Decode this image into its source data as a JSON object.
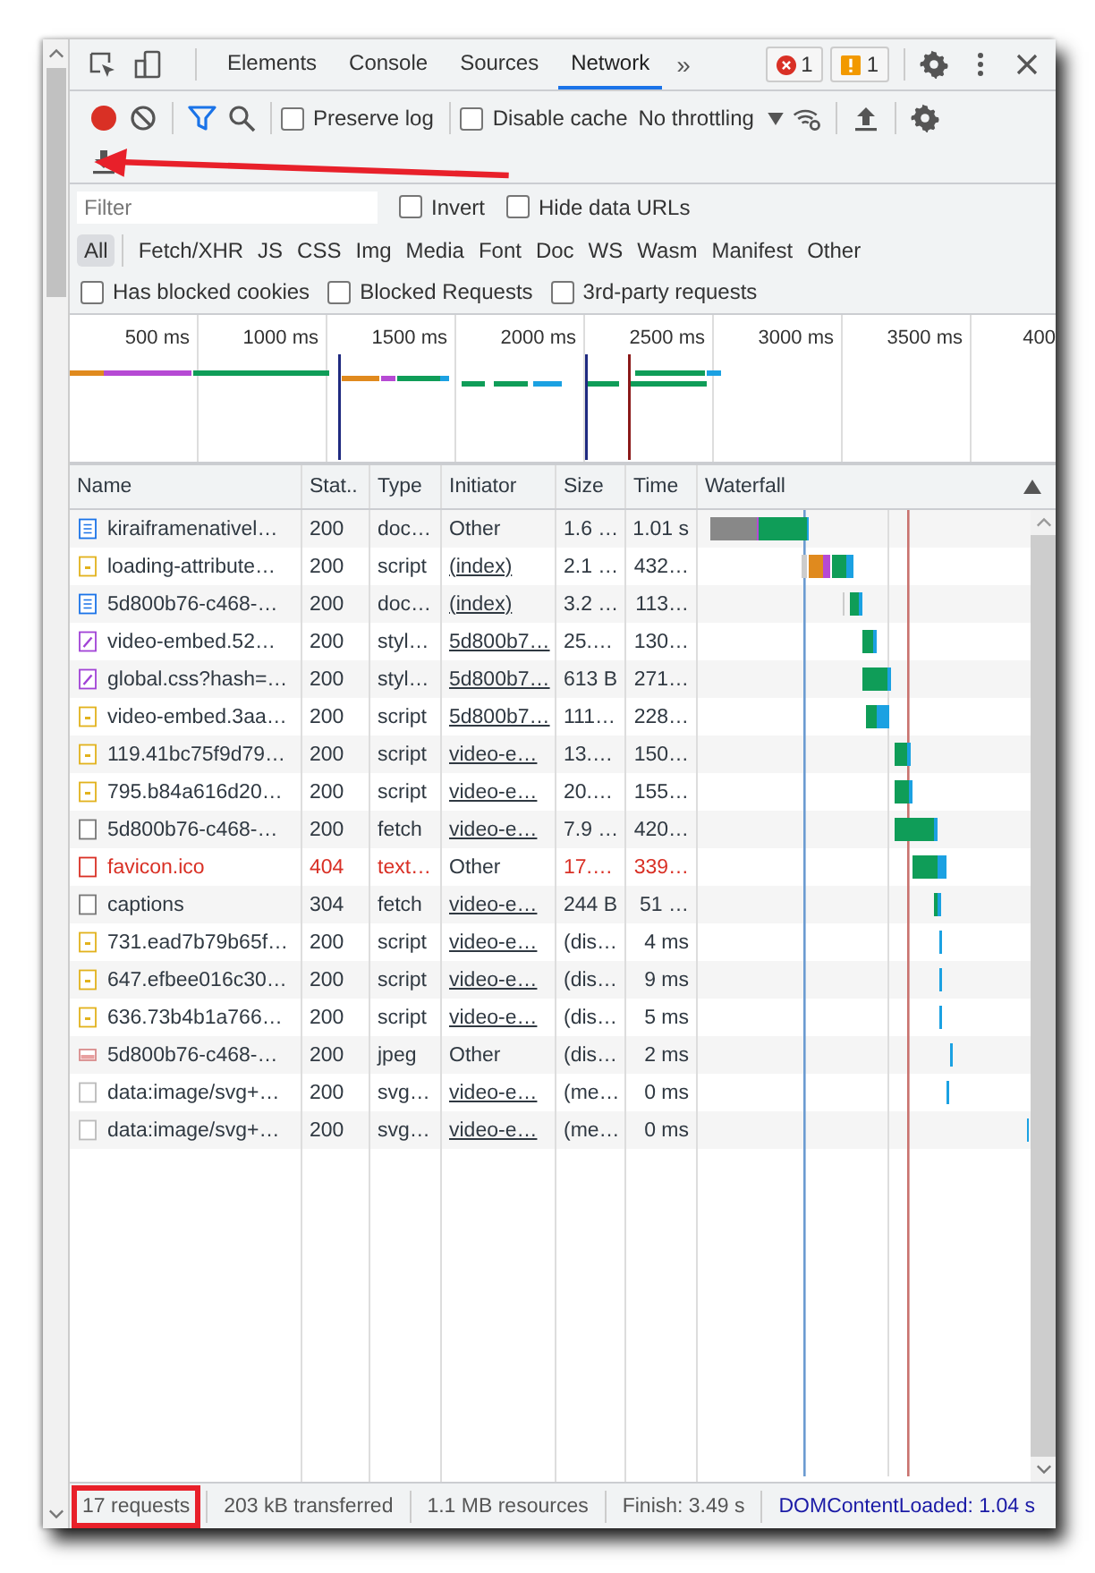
{
  "tabs": [
    {
      "label": "Elements",
      "selected": false
    },
    {
      "label": "Console",
      "selected": false
    },
    {
      "label": "Sources",
      "selected": false
    },
    {
      "label": "Network",
      "selected": true
    }
  ],
  "more_tabs": "»",
  "error_count": "1",
  "warning_count": "1",
  "toolbar": {
    "recording": true,
    "preserve_log": {
      "label": "Preserve log",
      "checked": false
    },
    "disable_cache": {
      "label": "Disable cache",
      "checked": false
    },
    "throttling": "No throttling"
  },
  "filter": {
    "placeholder": "Filter",
    "options": [
      {
        "label": "Invert",
        "checked": false
      },
      {
        "label": "Hide data URLs",
        "checked": false
      }
    ]
  },
  "types": [
    {
      "label": "All",
      "selected": true
    },
    {
      "label": "Fetch/XHR",
      "selected": false
    },
    {
      "label": "JS",
      "selected": false
    },
    {
      "label": "CSS",
      "selected": false
    },
    {
      "label": "Img",
      "selected": false
    },
    {
      "label": "Media",
      "selected": false
    },
    {
      "label": "Font",
      "selected": false
    },
    {
      "label": "Doc",
      "selected": false
    },
    {
      "label": "WS",
      "selected": false
    },
    {
      "label": "Wasm",
      "selected": false
    },
    {
      "label": "Manifest",
      "selected": false
    },
    {
      "label": "Other",
      "selected": false
    }
  ],
  "blocked_options": [
    {
      "label": "Has blocked cookies",
      "checked": false
    },
    {
      "label": "Blocked Requests",
      "checked": false
    },
    {
      "label": "3rd-party requests",
      "checked": false
    }
  ],
  "overview": {
    "ticks": [
      "500 ms",
      "1000 ms",
      "1500 ms",
      "2000 ms",
      "2500 ms",
      "3000 ms",
      "3500 ms",
      "400"
    ]
  },
  "columns": [
    "Name",
    "Stat..",
    "Type",
    "Initiator",
    "Size",
    "Time",
    "Waterfall"
  ],
  "rows": [
    {
      "kind": "doc",
      "name": "kiraiframenativel…",
      "status": "200",
      "type": "doc…",
      "initiator": "Other",
      "initiator_link": false,
      "size": "1.6 …",
      "time": "1.01 s",
      "failed": false
    },
    {
      "kind": "script",
      "name": "loading-attribute…",
      "status": "200",
      "type": "script",
      "initiator": "(index)",
      "initiator_link": true,
      "size": "2.1 …",
      "time": "432…",
      "failed": false
    },
    {
      "kind": "doc",
      "name": "5d800b76-c468-…",
      "status": "200",
      "type": "doc…",
      "initiator": "(index)",
      "initiator_link": true,
      "size": "3.2 …",
      "time": "113…",
      "failed": false
    },
    {
      "kind": "style",
      "name": "video-embed.52…",
      "status": "200",
      "type": "styl…",
      "initiator": "5d800b7…",
      "initiator_link": true,
      "size": "25.…",
      "time": "130…",
      "failed": false
    },
    {
      "kind": "style",
      "name": "global.css?hash=…",
      "status": "200",
      "type": "styl…",
      "initiator": "5d800b7…",
      "initiator_link": true,
      "size": "613 B",
      "time": "271…",
      "failed": false
    },
    {
      "kind": "script",
      "name": "video-embed.3aa…",
      "status": "200",
      "type": "script",
      "initiator": "5d800b7…",
      "initiator_link": true,
      "size": "111…",
      "time": "228…",
      "failed": false
    },
    {
      "kind": "script",
      "name": "119.41bc75f9d79…",
      "status": "200",
      "type": "script",
      "initiator": "video-e…",
      "initiator_link": true,
      "size": "13.…",
      "time": "150…",
      "failed": false
    },
    {
      "kind": "script",
      "name": "795.b84a616d20…",
      "status": "200",
      "type": "script",
      "initiator": "video-e…",
      "initiator_link": true,
      "size": "20.…",
      "time": "155…",
      "failed": false
    },
    {
      "kind": "fetch",
      "name": "5d800b76-c468-…",
      "status": "200",
      "type": "fetch",
      "initiator": "video-e…",
      "initiator_link": true,
      "size": "7.9 …",
      "time": "420…",
      "failed": false
    },
    {
      "kind": "fetch",
      "name": "favicon.ico",
      "status": "404",
      "type": "text…",
      "initiator": "Other",
      "initiator_link": false,
      "size": "17.…",
      "time": "339…",
      "failed": true
    },
    {
      "kind": "fetch",
      "name": "captions",
      "status": "304",
      "type": "fetch",
      "initiator": "video-e…",
      "initiator_link": true,
      "size": "244 B",
      "time": "51 …",
      "failed": false
    },
    {
      "kind": "script",
      "name": "731.ead7b79b65f…",
      "status": "200",
      "type": "script",
      "initiator": "video-e…",
      "initiator_link": true,
      "size": "(dis…",
      "time": "4 ms",
      "failed": false
    },
    {
      "kind": "script",
      "name": "647.efbee016c30…",
      "status": "200",
      "type": "script",
      "initiator": "video-e…",
      "initiator_link": true,
      "size": "(dis…",
      "time": "9 ms",
      "failed": false
    },
    {
      "kind": "script",
      "name": "636.73b4b1a766…",
      "status": "200",
      "type": "script",
      "initiator": "video-e…",
      "initiator_link": true,
      "size": "(dis…",
      "time": "5 ms",
      "failed": false
    },
    {
      "kind": "image",
      "name": "5d800b76-c468-…",
      "status": "200",
      "type": "jpeg",
      "initiator": "Other",
      "initiator_link": false,
      "size": "(dis…",
      "time": "2 ms",
      "failed": false
    },
    {
      "kind": "svg",
      "name": "data:image/svg+…",
      "status": "200",
      "type": "svg…",
      "initiator": "video-e…",
      "initiator_link": true,
      "size": "(me…",
      "time": "0 ms",
      "failed": false
    },
    {
      "kind": "svg",
      "name": "data:image/svg+…",
      "status": "200",
      "type": "svg…",
      "initiator": "video-e…",
      "initiator_link": true,
      "size": "(me…",
      "time": "0 ms",
      "failed": false
    }
  ],
  "summary": [
    {
      "kind": "plain",
      "text": "17 requests",
      "highlighted": true
    },
    {
      "kind": "plain",
      "text": "203 kB transferred",
      "highlighted": false
    },
    {
      "kind": "plain",
      "text": "1.1 MB resources",
      "highlighted": false
    },
    {
      "kind": "plain",
      "text": "Finish: 3.49 s",
      "highlighted": false
    },
    {
      "kind": "dcl",
      "text": "DOMContentLoaded: 1.04 s",
      "highlighted": false
    }
  ]
}
